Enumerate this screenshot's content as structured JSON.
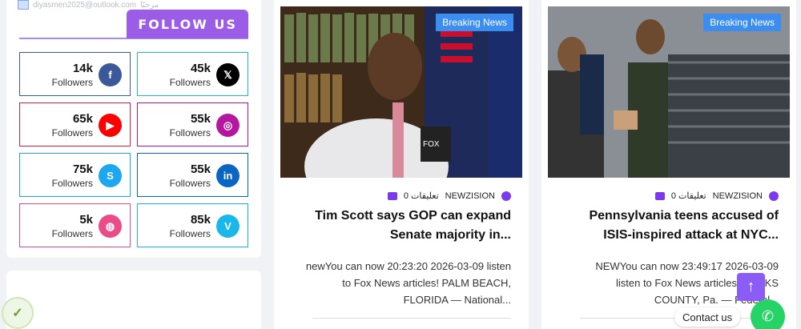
{
  "sidebar": {
    "email": "diyasmen2025@outlook.com",
    "welcome": "مرحبًا",
    "follow_label": "FOLLOW US",
    "social": [
      {
        "count": "14k",
        "label": "Followers",
        "icon": "facebook-icon",
        "glyph": "f",
        "color": "#3b5998",
        "border": "#3b5998"
      },
      {
        "count": "45k",
        "label": "Followers",
        "icon": "x-icon",
        "glyph": "𝕏",
        "color": "#000000",
        "border": "#22b8cf"
      },
      {
        "count": "65k",
        "label": "Followers",
        "icon": "youtube-icon",
        "glyph": "▶",
        "color": "#ff0000",
        "border": "#e11d48"
      },
      {
        "count": "55k",
        "label": "Followers",
        "icon": "instagram-icon",
        "glyph": "◎",
        "color": "#b5179e",
        "border": "#b5179e"
      },
      {
        "count": "75k",
        "label": "Followers",
        "icon": "skype-icon",
        "glyph": "S",
        "color": "#1ea7f1",
        "border": "#1ea7f1"
      },
      {
        "count": "55k",
        "label": "Followers",
        "icon": "linkedin-icon",
        "glyph": "in",
        "color": "#0a66c2",
        "border": "#0a66c2"
      },
      {
        "count": "5k",
        "label": "Followers",
        "icon": "dribbble-icon",
        "glyph": "◍",
        "color": "#ea4c89",
        "border": "#ea4c89"
      },
      {
        "count": "85k",
        "label": "Followers",
        "icon": "vimeo-icon",
        "glyph": "V",
        "color": "#1ab7ea",
        "border": "#1ab7ea"
      }
    ]
  },
  "articles": [
    {
      "badge": "Breaking News",
      "author": "NEWZISION",
      "comments": "0 تعليقات",
      "title": "Tim Scott says GOP can expand Senate majority in...",
      "excerpt": "newYou can now 20:23:20 2026-03-09 listen to Fox News articles! PALM BEACH, FLORIDA — National..."
    },
    {
      "badge": "Breaking News",
      "author": "NEWZISION",
      "comments": "0 تعليقات",
      "title": "Pennsylvania teens accused of ISIS-inspired attack at NYC...",
      "excerpt": "NEWYou can now 23:49:17 2026-03-09 listen to Fox News articles! BUCKS COUNTY, Pa. — Federal..."
    }
  ],
  "floating": {
    "contact_label": "Contact us",
    "scroll_top": "↑"
  }
}
